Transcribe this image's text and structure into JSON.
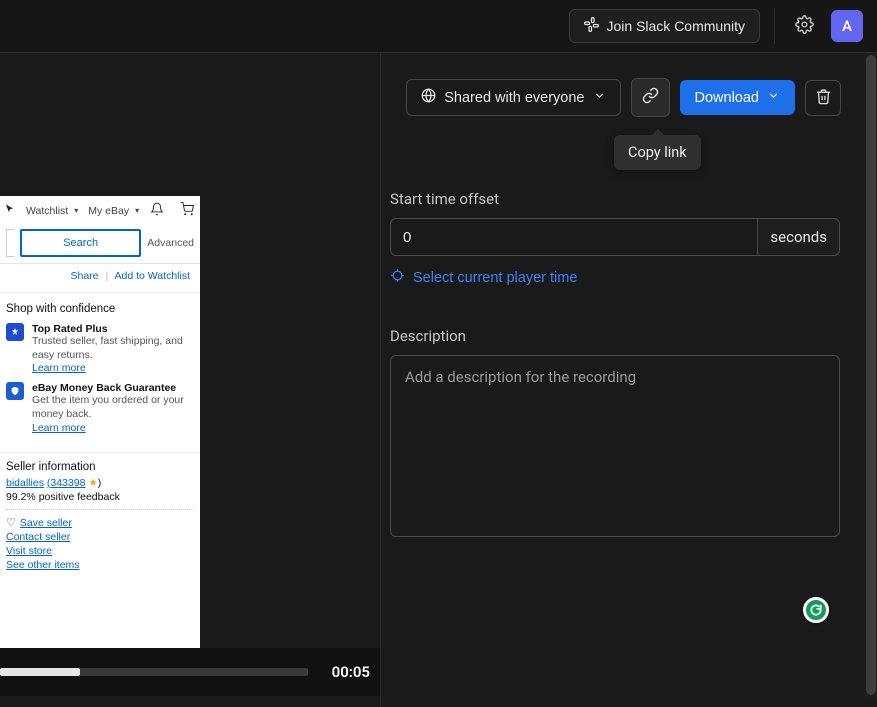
{
  "header": {
    "slack_label": "Join Slack Community",
    "avatar_initial": "A"
  },
  "toolbar": {
    "share_label": "Shared with everyone",
    "download_label": "Download"
  },
  "tooltip": {
    "copy_link": "Copy link"
  },
  "offset": {
    "label": "Start time offset",
    "value": "0",
    "unit": "seconds",
    "select_time_label": "Select current player time"
  },
  "description": {
    "label": "Description",
    "placeholder": "Add a description for the recording"
  },
  "player": {
    "timecode": "00:05"
  },
  "preview": {
    "nav": {
      "watchlist": "Watchlist",
      "myebay": "My eBay"
    },
    "search": {
      "button": "Search",
      "advanced": "Advanced"
    },
    "share": {
      "share": "Share",
      "watch": "Add to Watchlist"
    },
    "confidence": {
      "title": "Shop with confidence",
      "top_rated": {
        "title": "Top Rated Plus",
        "sub": "Trusted seller, fast shipping, and easy returns.",
        "learn": "Learn more"
      },
      "moneyback": {
        "title": "eBay Money Back Guarantee",
        "sub": "Get the item you ordered or your money back.",
        "learn": "Learn more"
      }
    },
    "seller": {
      "title": "Seller information",
      "name": "bidallies",
      "count": "(343398",
      "feedback": "99.2% positive feedback",
      "save": "Save seller",
      "contact": "Contact seller",
      "visit": "Visit store",
      "other": "See other items"
    }
  }
}
